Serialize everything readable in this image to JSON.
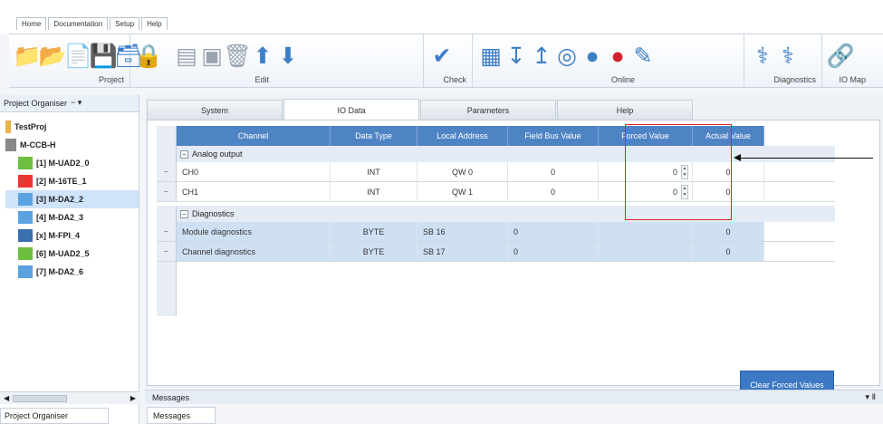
{
  "menu": {
    "tabs": [
      "Home",
      "Documentation",
      "Setup",
      "Help"
    ]
  },
  "ribbon": {
    "groups": [
      {
        "label": "Project"
      },
      {
        "label": "Edit"
      },
      {
        "label": "Check"
      },
      {
        "label": "Online"
      },
      {
        "label": "Diagnostics"
      },
      {
        "label": "IO Map"
      }
    ]
  },
  "sidebar": {
    "title": "Project Organiser",
    "pin": "− ▾",
    "tree": [
      {
        "label": "TestProj",
        "icon": "folder-icon"
      },
      {
        "label": "M-CCB-H",
        "icon": "controller-icon"
      },
      {
        "label": "[1] M-UAD2_0",
        "icon": "module-icon"
      },
      {
        "label": "[2] M-16TE_1",
        "icon": "module-icon"
      },
      {
        "label": "[3] M-DA2_2",
        "icon": "module-icon"
      },
      {
        "label": "[4] M-DA2_3",
        "icon": "module-icon"
      },
      {
        "label": "[x] M-FPI_4",
        "icon": "module-icon"
      },
      {
        "label": "[6] M-UAD2_5",
        "icon": "module-icon"
      },
      {
        "label": "[7] M-DA2_6",
        "icon": "module-icon"
      }
    ],
    "footer_tab": "Project Organiser"
  },
  "tabs": [
    "System",
    "IO Data",
    "Parameters",
    "Help"
  ],
  "grid": {
    "columns": [
      "Channel",
      "Data Type",
      "Local Address",
      "Field Bus Value",
      "Forced Value",
      "Actual Value"
    ],
    "groups": [
      {
        "label": "Analog output",
        "rows": [
          {
            "channel": "CH0",
            "type": "INT",
            "address": "QW 0",
            "fieldbus": "0",
            "forced": "0",
            "actual": "0"
          },
          {
            "channel": "CH1",
            "type": "INT",
            "address": "QW 1",
            "fieldbus": "0",
            "forced": "0",
            "actual": "0"
          }
        ]
      },
      {
        "label": "Diagnostics",
        "rows": [
          {
            "channel": "Module diagnostics",
            "type": "BYTE",
            "address": "SB 16",
            "fieldbus": "0",
            "forced": "",
            "actual": "0"
          },
          {
            "channel": "Channel diagnostics",
            "type": "BYTE",
            "address": "SB 17",
            "fieldbus": "0",
            "forced": "",
            "actual": "0"
          }
        ]
      }
    ]
  },
  "clear_button": "Clear Forced Values",
  "messages": {
    "title": "Messages",
    "pin": "▾ Ⅱ",
    "tab": "Messages"
  },
  "colors": {
    "header": "#4f84c4",
    "selection": "#cfe0f3",
    "highlight_box": "#e02424",
    "icon_blue": "#3d7fc7"
  }
}
